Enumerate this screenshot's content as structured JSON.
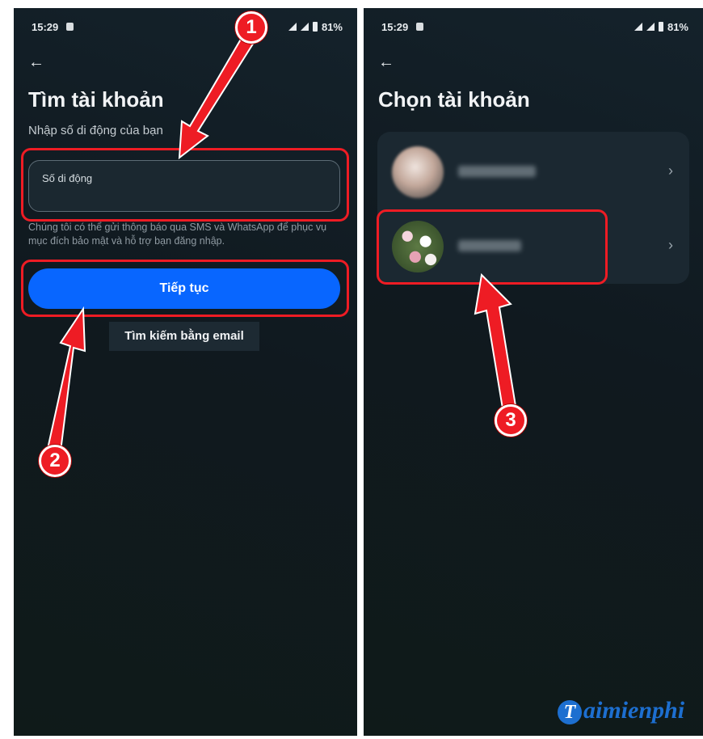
{
  "left": {
    "status": {
      "time": "15:29",
      "battery": "81%"
    },
    "title": "Tìm tài khoản",
    "subtitle": "Nhập số di động của bạn",
    "phone_field": {
      "label": "Số di động"
    },
    "hint": "Chúng tôi có thể gửi thông báo qua SMS và WhatsApp để phục vụ mục đích bảo mật và hỗ trợ bạn đăng nhập.",
    "continue_button": "Tiếp tục",
    "search_email_button": "Tìm kiếm bằng email"
  },
  "right": {
    "status": {
      "time": "15:29",
      "battery": "81%"
    },
    "title": "Chọn tài khoản",
    "accounts": [
      {
        "chevron": "›"
      },
      {
        "chevron": "›"
      }
    ],
    "watermark": {
      "letter": "T",
      "text": "aimienphi"
    }
  },
  "annotations": {
    "step1": "1",
    "step2": "2",
    "step3": "3",
    "color": "#ee1c24"
  },
  "colors": {
    "primary_button": "#0866ff",
    "background": "#10191f"
  },
  "icons": [
    "back-arrow-icon",
    "chevron-right-icon",
    "signal-icon",
    "battery-icon",
    "lock-icon"
  ]
}
